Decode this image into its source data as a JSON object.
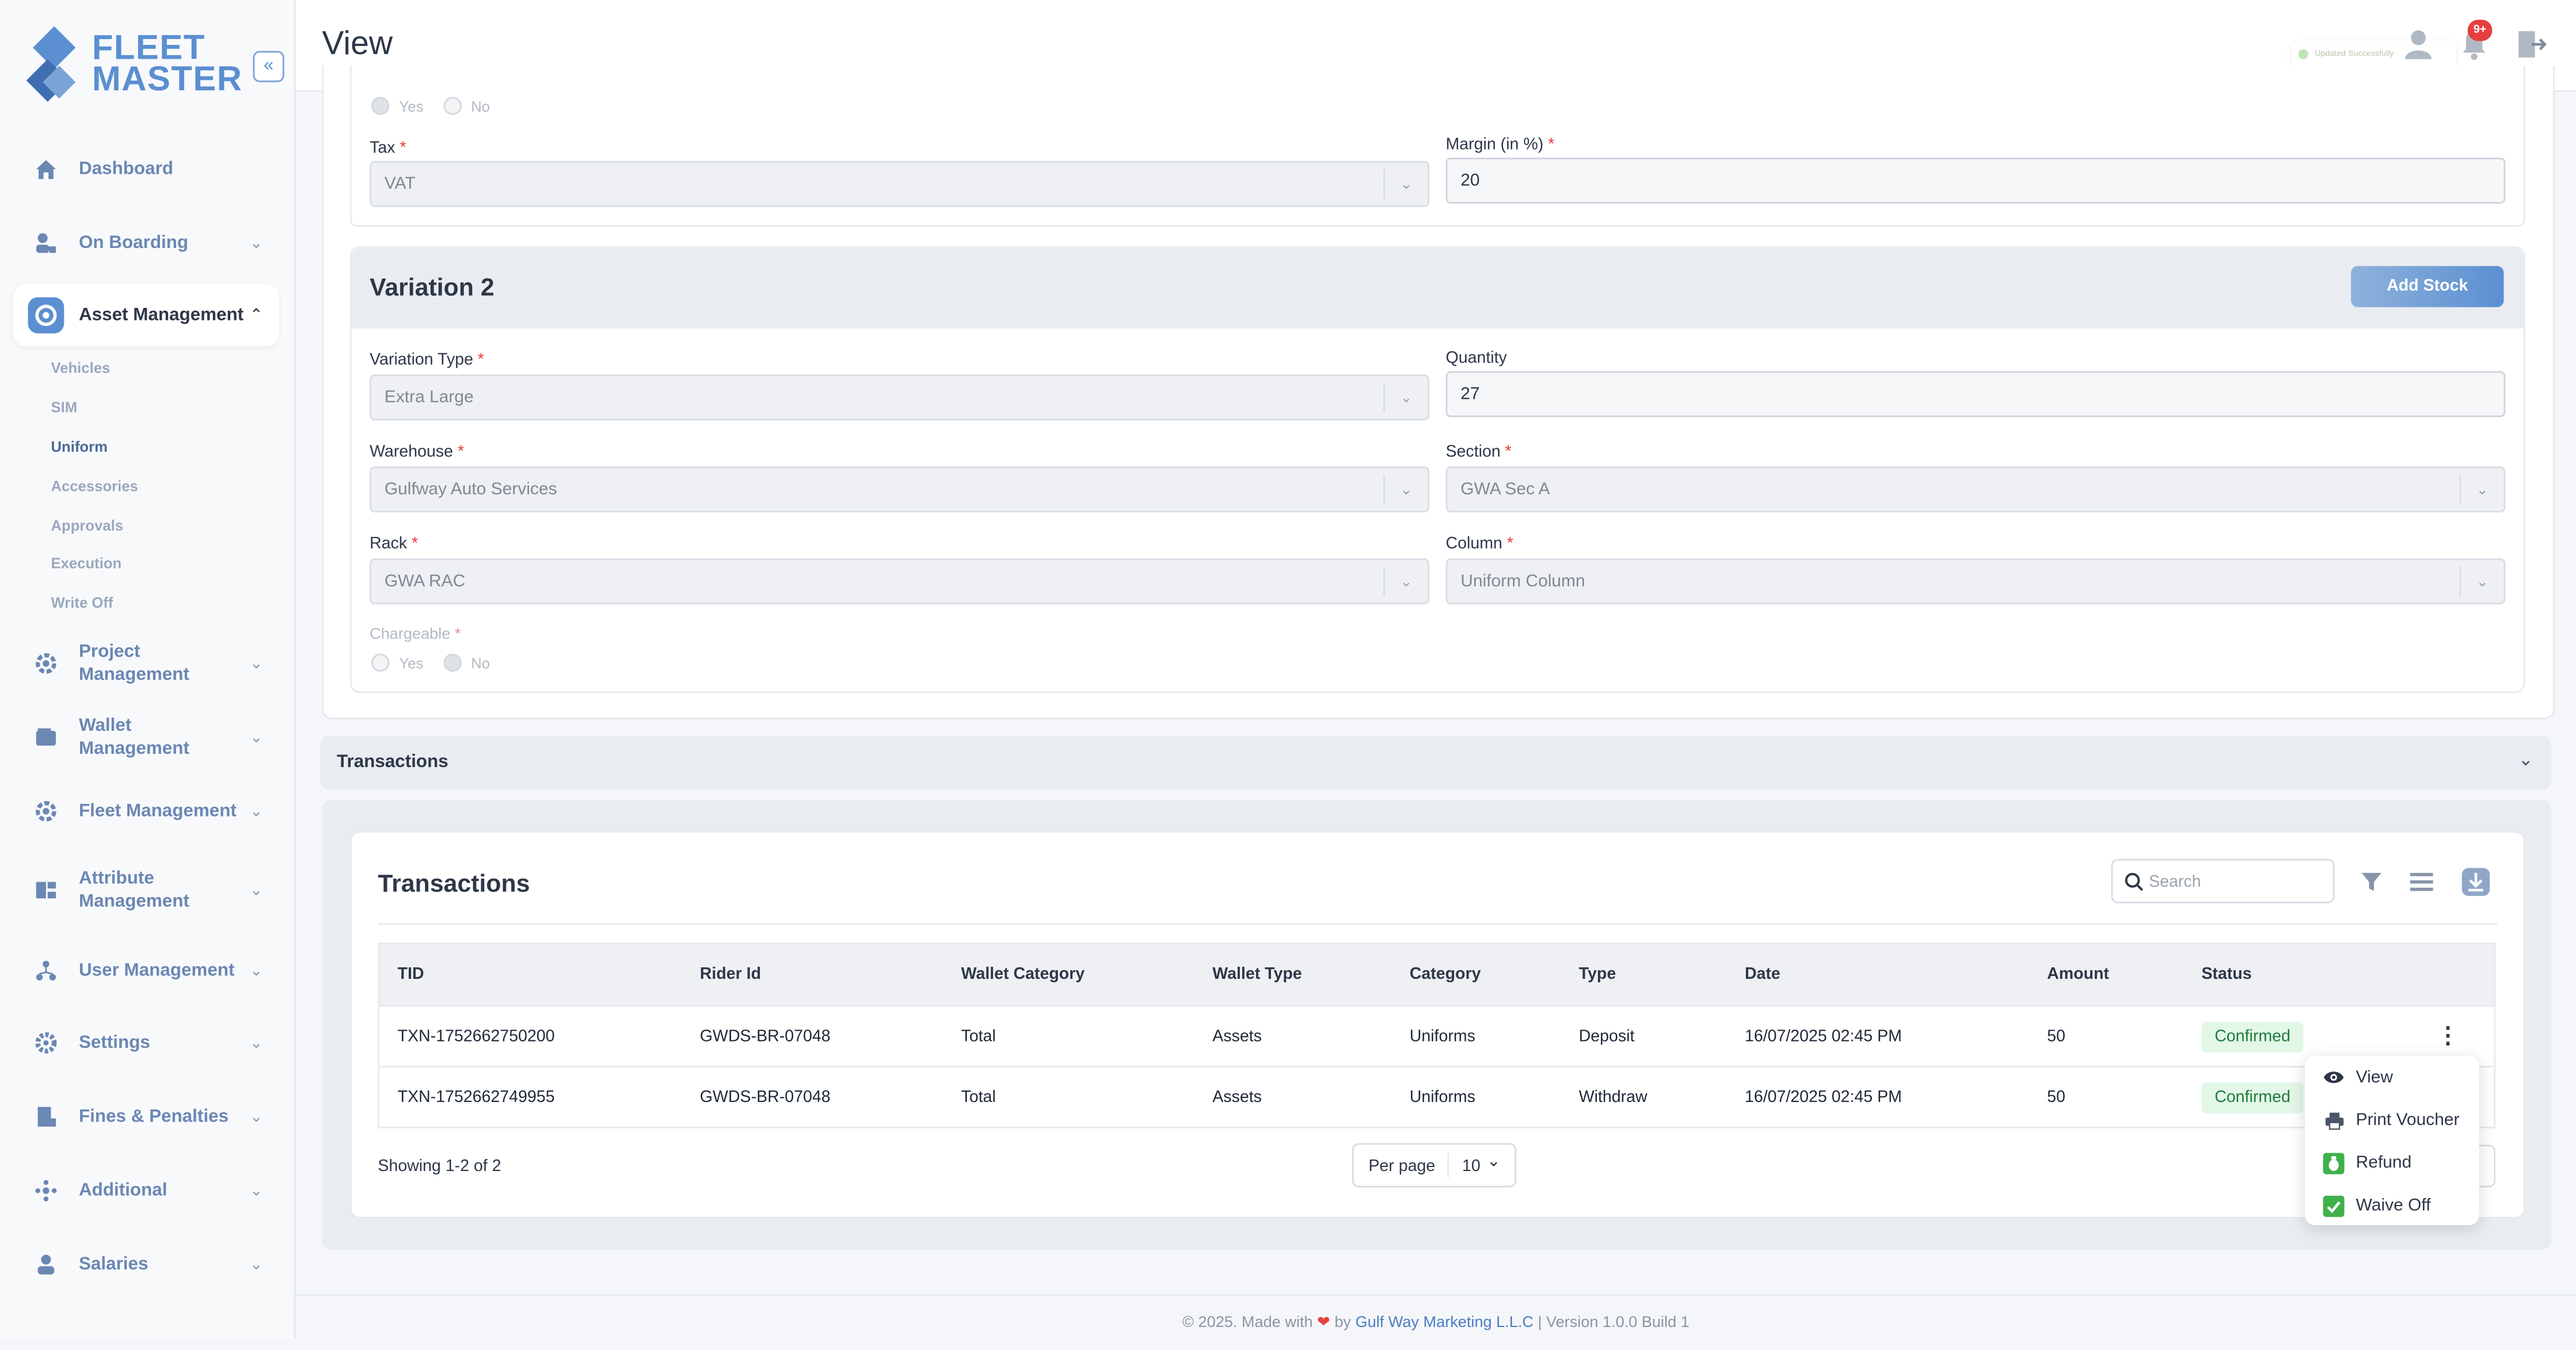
{
  "app": {
    "logo_line1": "FLEET",
    "logo_line2": "MASTER",
    "collapse": "«"
  },
  "header": {
    "title": "View",
    "toast": "Updated Successfully",
    "notif_badge": "9+"
  },
  "sidebar": {
    "items": [
      {
        "label": "Dashboard",
        "icon": "home-icon"
      },
      {
        "label": "On Boarding",
        "icon": "onboarding-icon"
      },
      {
        "label": "Asset Management",
        "icon": "asset-icon"
      },
      {
        "label": "Project Management",
        "icon": "project-icon"
      },
      {
        "label": "Wallet Management",
        "icon": "wallet-icon"
      },
      {
        "label": "Fleet Management",
        "icon": "fleet-icon"
      },
      {
        "label": "Attribute Management",
        "icon": "attribute-icon"
      },
      {
        "label": "User Management",
        "icon": "user-mgmt-icon"
      },
      {
        "label": "Settings",
        "icon": "gear-icon"
      },
      {
        "label": "Fines & Penalties",
        "icon": "fines-icon"
      },
      {
        "label": "Additional",
        "icon": "additional-icon"
      },
      {
        "label": "Salaries",
        "icon": "salaries-icon"
      }
    ],
    "sub_items": [
      "Vehicles",
      "SIM",
      "Uniform",
      "Accessories",
      "Approvals",
      "Execution",
      "Write Off"
    ]
  },
  "variation1": {
    "yes": "Yes",
    "no": "No",
    "tax_label": "Tax",
    "tax_value": "VAT",
    "margin_label": "Margin (in %)",
    "margin_value": "20"
  },
  "variation2": {
    "title": "Variation 2",
    "add_stock": "Add Stock",
    "variation_type_label": "Variation Type",
    "variation_type_value": "Extra Large",
    "quantity_label": "Quantity",
    "quantity_value": "27",
    "warehouse_label": "Warehouse",
    "warehouse_value": "Gulfway Auto Services",
    "section_label": "Section",
    "section_value": "GWA Sec A",
    "rack_label": "Rack",
    "rack_value": "GWA RAC",
    "column_label": "Column",
    "column_value": "Uniform Column",
    "chargeable_label": "Chargeable",
    "yes": "Yes",
    "no": "No"
  },
  "transactions": {
    "accordion_title": "Transactions",
    "card_title": "Transactions",
    "search_placeholder": "Search",
    "columns": [
      "TID",
      "Rider Id",
      "Wallet Category",
      "Wallet Type",
      "Category",
      "Type",
      "Date",
      "Amount",
      "Status"
    ],
    "rows": [
      [
        "TXN-1752662750200",
        "GWDS-BR-07048",
        "Total",
        "Assets",
        "Uniforms",
        "Deposit",
        "16/07/2025 02:45 PM",
        "50",
        "Confirmed"
      ],
      [
        "TXN-1752662749955",
        "GWDS-BR-07048",
        "Total",
        "Assets",
        "Uniforms",
        "Withdraw",
        "16/07/2025 02:45 PM",
        "50",
        "Confirmed"
      ]
    ],
    "showing": "Showing 1-2 of 2",
    "per_page_label": "Per page",
    "per_page_value": "10"
  },
  "action_menu": {
    "items": [
      {
        "label": "View",
        "icon": "eye-icon"
      },
      {
        "label": "Print Voucher",
        "icon": "printer-icon"
      },
      {
        "label": "Refund",
        "icon": "refund-icon"
      },
      {
        "label": "Waive Off",
        "icon": "waive-off-icon"
      }
    ]
  },
  "footer": {
    "prefix": "© 2025. Made with",
    "by": "by",
    "company": "Gulf Way Marketing L.L.C",
    "version": "| Version 1.0.0 Build 1"
  },
  "colors": {
    "accent": "#5b8fd1",
    "status_bg": "#e3f7e8",
    "status_text": "#1f7a3a",
    "badge": "#e53e3e"
  }
}
